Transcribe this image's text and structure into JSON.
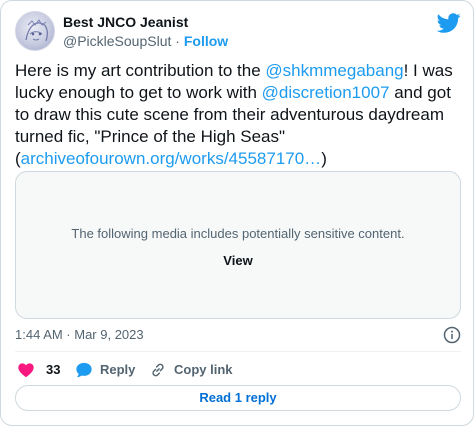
{
  "user": {
    "display_name": "Best JNCO Jeanist",
    "handle": "@PickleSoupSlut",
    "separator": "·",
    "follow_label": "Follow"
  },
  "tweet": {
    "text_1": "Here is my art contribution to the ",
    "mention_1": "@shkmmegabang",
    "text_2": "! I was lucky enough to get to work with ",
    "mention_2": "@discretion1007",
    "text_3": " and got to draw this cute scene from their adventurous daydream turned fic, \"Prince of the High Seas\" (",
    "link": "archiveofourown.org/works/45587170…",
    "text_4": ")"
  },
  "media": {
    "warning": "The following media includes potentially sensitive content.",
    "view_label": "View"
  },
  "meta": {
    "timestamp": "1:44 AM · Mar 9, 2023"
  },
  "actions": {
    "like_count": "33",
    "reply_label": "Reply",
    "copy_link_label": "Copy link",
    "read_replies_label": "Read 1 reply"
  },
  "colors": {
    "accent": "#1d9bf0",
    "like": "#f91880",
    "muted": "#536471",
    "border": "#cfd9de"
  },
  "icons": {
    "brand": "twitter-bird-icon",
    "like": "heart-icon",
    "reply": "speech-bubble-icon",
    "copy": "link-icon",
    "info": "info-icon"
  }
}
